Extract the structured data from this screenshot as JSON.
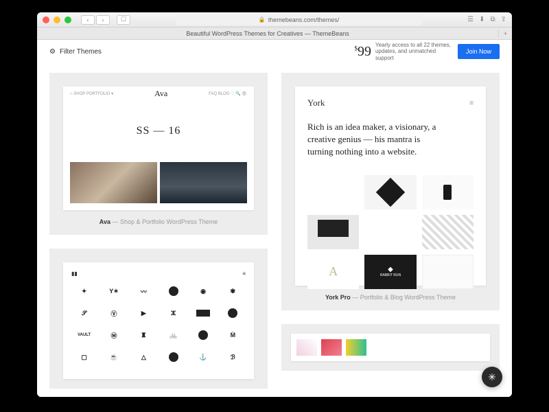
{
  "browser": {
    "url": "themebeans.com/themes/",
    "tab_title": "Beautiful WordPress Themes for Creatives — ThemeBeans"
  },
  "topbar": {
    "filter_label": "Filter Themes",
    "price_prefix": "$",
    "price": "99",
    "price_desc": "Yearly access to all 22 themes, updates, and unmatched support",
    "join_label": "Join Now"
  },
  "themes": {
    "ava": {
      "name": "Ava",
      "desc": " — Shop & Portfolio WordPress Theme",
      "logo": "Ava",
      "hero_title": "SS — 16",
      "nav_left": "⌂  SHOP  PORTFOLIO  ▾",
      "nav_right": "FAQ  BLOG  ♡  🔍  🛍"
    },
    "york": {
      "name": "York Pro",
      "desc": " — Portfolio & Blog WordPress Theme",
      "logo": "York",
      "hero_text": "Rich is an idea maker, a visionary, a creative genius — his mantra is turning nothing into a website.",
      "letter": "A",
      "dark_label": "RABBIT RUN"
    },
    "logos": {
      "brand": "▮▮",
      "menu": "≡"
    }
  },
  "help_icon": "✳"
}
